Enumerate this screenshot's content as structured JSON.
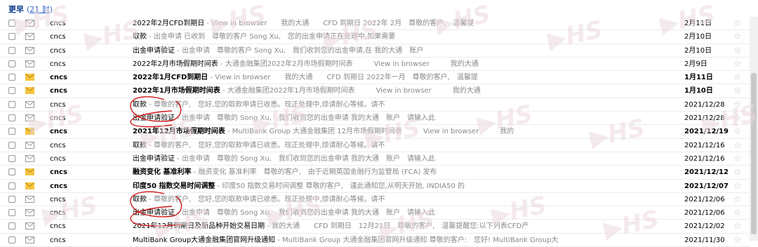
{
  "header": {
    "title": "更早",
    "count_open": "(",
    "count_link": "21 封",
    "count_close": ")"
  },
  "icons": {
    "checkbox": "checkbox-icon",
    "envelope_read": "envelope-read-icon",
    "envelope_unread": "envelope-unread-icon",
    "star": "star-icon"
  },
  "colors": {
    "unread_envelope": "#f5c542",
    "read_envelope": "#9a9a9a",
    "annotation": "#d01818",
    "watermark": "#ecd9de"
  },
  "watermark_text": "HS",
  "star_glyph": "☆",
  "emails": [
    {
      "sender": "cncs",
      "subject": "2022年2月CFD到期日",
      "snippet": " - View in browser　　我的大通　　CFD 到期日 2022年 2月　尊敬的客户,　温馨提",
      "date": "2月11日",
      "unread": false
    },
    {
      "sender": "cncs",
      "subject": "取款",
      "snippet": " - 出金申请 已收到　尊敬的客户 Song Xu,　您的出金申请正在处理中,如果需要",
      "date": "2月10日",
      "unread": false
    },
    {
      "sender": "cncs",
      "subject": "出金申请验证",
      "snippet": " - 出金申请　尊敬的客户 Song Xu,　我们收到您的出金申请,在 我的大通　账户",
      "date": "2月10日",
      "unread": false
    },
    {
      "sender": "cncs",
      "subject": "2022年2月市场假期时间表",
      "snippet": " - 大通金融集团2022年2月市场假期时间表　　　View in browser　　　我的大通",
      "date": "2月9日",
      "unread": false
    },
    {
      "sender": "cncs",
      "subject": "2022年1月CFD到期日",
      "snippet": " - View in browser　　我的大通　　CFD 到期日 2022年一月　尊敬的客户,　温馨提",
      "date": "1月11日",
      "unread": true
    },
    {
      "sender": "cncs",
      "subject": "2022年1月市场假期时间表",
      "snippet": " - 大通金融集团2022年1月市场假期时间表　　　View in browser　　　我的大通",
      "date": "1月10日",
      "unread": true
    },
    {
      "sender": "cncs",
      "subject": "取款",
      "snippet": " - 尊敬的客户,　您好,您的取款申请已收悉。现正处理中,烦请耐心等候。请不",
      "date": "2021/12/28",
      "unread": false
    },
    {
      "sender": "cncs",
      "subject": "出金申请验证",
      "snippet": " - 出金申请　尊敬的 Song Xu,　我们收到您的出金申请 我的大通　账户　请输入此",
      "date": "2021/12/28",
      "unread": false
    },
    {
      "sender": "cncs",
      "subject": "2021年12月市场假期时间表",
      "snippet": " - MultiBank Group 大通金融集团 12月市场假期时间表　　　View in browser　　　我的",
      "date": "2021/12/19",
      "unread": true
    },
    {
      "sender": "cncs",
      "subject": "取款",
      "snippet": " - 尊敬的客户,　您好,您的取款申请已收悉。现正处理中,烦请耐心等候。请不",
      "date": "2021/12/16",
      "unread": false
    },
    {
      "sender": "cncs",
      "subject": "出金申请验证",
      "snippet": " - 出金申请　尊敬的 Song Xu,　我们收到您的出金申请 我的大通　账户　请输入此",
      "date": "2021/12/16",
      "unread": false
    },
    {
      "sender": "cncs",
      "subject": "融资变化 基准利率",
      "snippet": " - 融资变化 基准利率　尊敬的客户,　由于近期英国金融行为监管局 (FCA) 发布",
      "date": "2021/12/12",
      "unread": true
    },
    {
      "sender": "cncs",
      "subject": "印度50 指数交易时间调整",
      "snippet": " - 印度50 指数交易时间调整 尊敬的客户,　谨此通知您,从明天开始, INDIA50 的",
      "date": "2021/12/07",
      "unread": true
    },
    {
      "sender": "cncs",
      "subject": "取款",
      "snippet": " - 尊敬的客户,　您好,您的取款申请已收悉。现正处理中,烦请耐心等候。请不",
      "date": "2021/12/06",
      "unread": false
    },
    {
      "sender": "cncs",
      "subject": "出金申请验证",
      "snippet": " - 出金申请　尊敬的 Song Xu,　我们收到您的出金申请 我的大通　账户　请输入此",
      "date": "2021/12/06",
      "unread": false
    },
    {
      "sender": "cncs",
      "subject": "2021年12月到期日及新品种开始交易日期",
      "snippet": " - 我的大通　　CFD 到期日　12月21日　尊敬的客户,　温馨提醒您:以下列表CFD产",
      "date": "2021/12/02",
      "unread": false
    },
    {
      "sender": "cncs",
      "subject": "MultiBank Group大通金融集团官网升级通知",
      "snippet": " - MultiBank Group 大通金融集团官网升级通知 尊敬的客户:　您好! MultiBank Group大",
      "date": "2021/11/30",
      "unread": false
    }
  ]
}
